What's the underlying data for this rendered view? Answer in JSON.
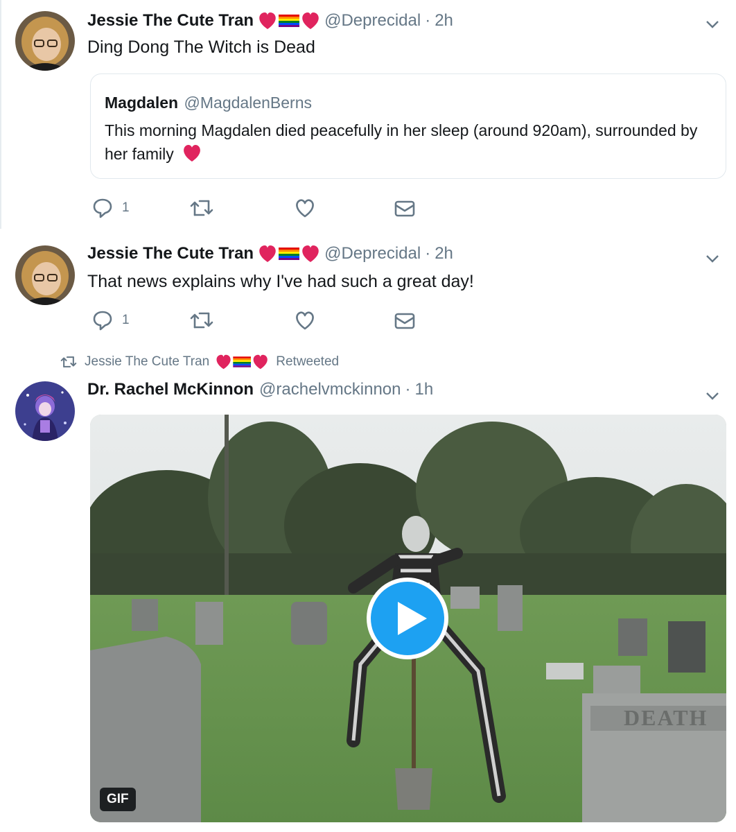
{
  "tweets": [
    {
      "author_name": "Jessie The Cute Tran",
      "handle": "@Deprecidal",
      "separator": "·",
      "time": "2h",
      "text": "Ding Dong The Witch is Dead",
      "reply_count": "1",
      "quoted": {
        "author_name": "Magdalen",
        "handle": "@MagdalenBerns",
        "text": "This morning Magdalen died peacefully in her sleep  (around 920am), surrounded by her family"
      }
    },
    {
      "author_name": "Jessie The Cute Tran",
      "handle": "@Deprecidal",
      "separator": "·",
      "time": "2h",
      "text": "That news explains why I've had such a great day!",
      "reply_count": "1"
    },
    {
      "retweeted_by": "Jessie The Cute Tran",
      "retweeted_label": "Retweeted",
      "author_name": "Dr. Rachel McKinnon",
      "handle": "@rachelvmckinnon",
      "separator": "·",
      "time": "1h",
      "media_badge": "GIF",
      "media_sign_text": "DEATH"
    }
  ],
  "icons": [
    "heart-emoji",
    "rainbow-flag-emoji",
    "reply-icon",
    "retweet-icon",
    "like-icon",
    "dm-icon",
    "chevron-down-icon",
    "play-icon"
  ],
  "colors": {
    "heart": "#e0245e",
    "muted": "#657786",
    "play": "#1da1f2"
  }
}
